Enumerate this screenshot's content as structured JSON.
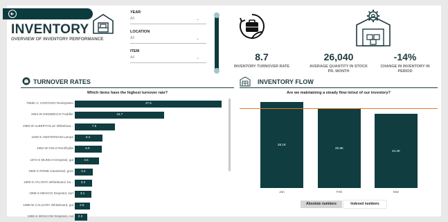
{
  "header": {
    "title": "INVENTORY",
    "subtitle": "OVERVIEW OF INVENTORY PERFORMANCE"
  },
  "filters": [
    {
      "label": "YEAR",
      "value": "All"
    },
    {
      "label": "LOCATION",
      "value": "All"
    },
    {
      "label": "ITEM",
      "value": "All"
    }
  ],
  "kpis": [
    {
      "value": "8.7",
      "caption": "INVENTORY TURNOVER RATE"
    },
    {
      "value": "26,040",
      "caption": "AVERAGE QUANTITY IN STOCK PR. MONTH"
    },
    {
      "value": "-14%",
      "caption": "CHANGE IN INVENTORY IN PERIOD"
    }
  ],
  "turnover": {
    "section_title": "TURNOVER RATES",
    "question": "Which items have the highest turnover rate?"
  },
  "flow": {
    "section_title": "INVENTORY FLOW",
    "question": "Are we maintaining a steady flow in/out of our inventory?",
    "toggle_absolute": "Absolute numbers",
    "toggle_indexed": "Indexed numbers"
  },
  "chart_data": [
    {
      "type": "bar",
      "orientation": "horizontal",
      "title": "Which items have the highest turnover rate?",
      "categories": [
        "7668C-C CONTOSO Reolsystem",
        "1954-W INKEBRUCK Paddler",
        "1960-W ALBERTVILLE Whiteboar...",
        "1928-S AMSTERDAM Lampe",
        "1952-W OSLO Reol/hylde",
        "1972-S MUNICH Drejestol, gul",
        "1960-S ROME Gaestestol, gron",
        "1980-S ATLANTA Whiteboard, ba...",
        "1988-S MEXICO Drejestol, sort",
        "1988-W CALGARY Whiteboard, gul",
        "1980-S MOSCOW Drejestol, rod"
      ],
      "values": [
        27.5,
        16.7,
        7.5,
        5.2,
        5.0,
        4.5,
        3.4,
        3.3,
        3.1,
        2.9,
        2.3
      ],
      "value_labels": [
        "27.5",
        "16.7",
        "7.5",
        "5.2",
        "5.0",
        "4.5",
        "3.4",
        "3.3",
        "3.1",
        "2.9",
        "2.3"
      ]
    },
    {
      "type": "bar",
      "orientation": "vertical",
      "title": "Are we maintaining a steady flow in/out of our inventory?",
      "categories": [
        "Jan",
        "Feb",
        "Mar"
      ],
      "values": [
        28.1,
        25.8,
        24.2
      ],
      "value_labels": [
        "28.1K",
        "25.8K",
        "24.2K"
      ],
      "reference_line": 26.04,
      "ylim": [
        0,
        29
      ]
    }
  ],
  "colors": {
    "primary": "#0f3d40",
    "accent_line": "#e6772e",
    "background": "#e9e9e9"
  }
}
